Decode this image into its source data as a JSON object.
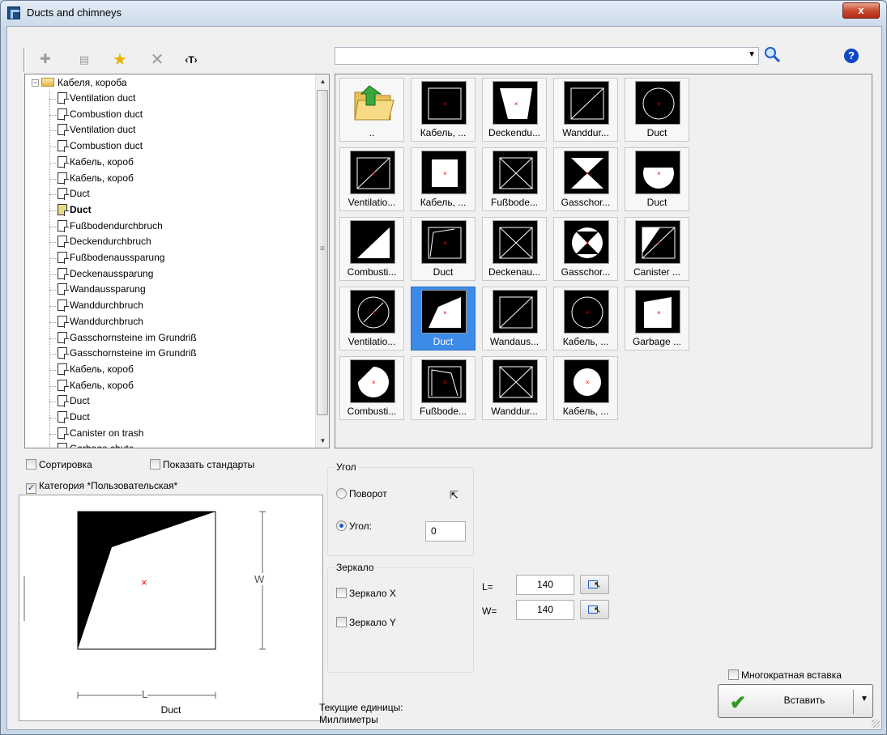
{
  "window": {
    "title": "Ducts and chimneys",
    "close_label": "x"
  },
  "toolbar": {
    "buttons": [
      {
        "name": "add-icon",
        "glyph": "✚"
      },
      {
        "name": "properties-icon",
        "glyph": "▤"
      },
      {
        "name": "favorite-star-icon",
        "glyph": "★"
      },
      {
        "name": "delete-icon",
        "glyph": "✕"
      },
      {
        "name": "text-tag-icon",
        "glyph": "‹T›"
      }
    ],
    "search": {
      "value": "",
      "placeholder": ""
    }
  },
  "tree": {
    "root": "Кабеля, короба",
    "items": [
      "Ventilation duct",
      "Combustion duct",
      "Ventilation duct",
      "Combustion duct",
      "Кабель, короб",
      "Кабель, короб",
      "Duct",
      "Duct",
      "Fußbodendurchbruch",
      "Deckendurchbruch",
      "Fußbodenaussparung",
      "Deckenaussparung",
      "Wandaussparung",
      "Wanddurchbruch",
      "Wanddurchbruch",
      "Gasschornsteine im Grundriß",
      "Gasschornsteine im Grundriß",
      "Кабель, короб",
      "Кабель, короб",
      "Duct",
      "Duct",
      "Canister on trash",
      "Garbage chute"
    ],
    "selected_index": 7
  },
  "gallery": {
    "tiles": [
      "..",
      "Кабель, ...",
      "Deckendu...",
      "Wanddur...",
      "Duct",
      "Ventilatio...",
      "Кабель, ...",
      "Fußbode...",
      "Gasschor...",
      "Duct",
      "Combusti...",
      "Duct",
      "Deckenau...",
      "Gasschor...",
      "Canister ...",
      "Ventilatio...",
      "Duct",
      "Wandaus...",
      "Кабель, ...",
      "Garbage ...",
      "Combusti...",
      "Fußbode...",
      "Wanddur...",
      "Кабель, ..."
    ],
    "selected_index": 16
  },
  "options": {
    "sort_label": "Сортировка",
    "show_standards_label": "Показать стандарты",
    "category_label": "Категория *Пользовательская*",
    "category_checked": true
  },
  "preview": {
    "name": "Duct",
    "dim_w": "W",
    "dim_l": "L"
  },
  "angle": {
    "group_title": "Угол",
    "rotate_label": "Поворот",
    "angle_label": "Угол:",
    "angle_value": "0",
    "selected": "angle"
  },
  "mirror": {
    "group_title": "Зеркало",
    "mirror_x_label": "Зеркало X",
    "mirror_y_label": "Зеркало Y"
  },
  "dimensions": {
    "l_label": "L=",
    "l_value": "140",
    "w_label": "W=",
    "w_value": "140"
  },
  "footer": {
    "multi_insert_label": "Многократная вставка",
    "insert_label": "Вставить",
    "units_line1": "Текущие единицы:",
    "units_line2": "Миллиметры"
  },
  "colors": {
    "selection": "#3c8be6",
    "close": "#c84b32",
    "help": "#1046c8",
    "insert_check": "#2f9a1f"
  }
}
